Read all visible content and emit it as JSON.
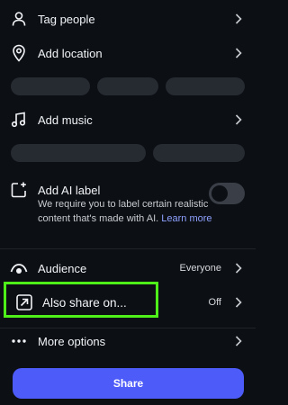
{
  "rows": {
    "tag_people": {
      "label": "Tag people",
      "icon": "person-icon"
    },
    "add_location": {
      "label": "Add location",
      "icon": "location-pin-icon"
    },
    "add_music": {
      "label": "Add music",
      "icon": "music-note-icon"
    },
    "add_ai_label": {
      "label": "Add AI label",
      "icon": "ai-label-icon",
      "description": "We require you to label certain realistic content that's made with AI.",
      "link": "Learn more",
      "toggle_on": false
    },
    "audience": {
      "label": "Audience",
      "value": "Everyone",
      "icon": "eye-icon"
    },
    "also_share": {
      "label": "Also share on...",
      "value": "Off",
      "icon": "share-arrow-icon"
    },
    "more_options": {
      "label": "More options",
      "icon": "more-dots-icon"
    }
  },
  "share_button": {
    "label": "Share",
    "color": "#4d5bf9"
  },
  "colors": {
    "background": "#0c0f14",
    "highlight": "#4ff01a",
    "suggestion_chip": "#262a31"
  }
}
